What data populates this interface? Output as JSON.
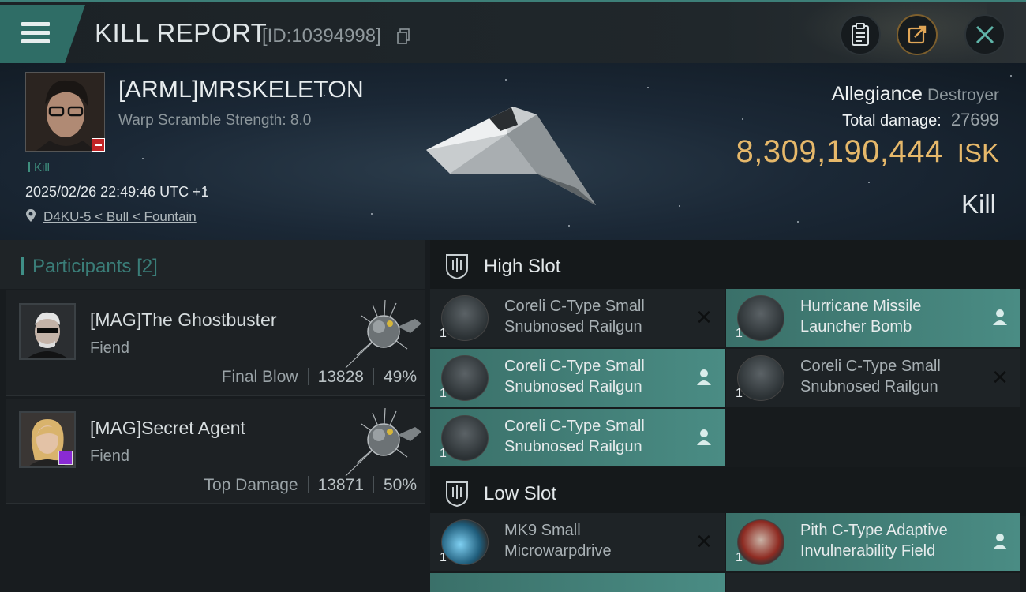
{
  "header": {
    "title": "KILL REPORT",
    "report_id": "[ID:10394998]",
    "icons": [
      "menu-icon",
      "copy-icon",
      "clipboard-icon",
      "share-icon",
      "close-icon"
    ]
  },
  "victim": {
    "name": "[ARML]MRSKELETON",
    "warp_scramble": "Warp Scramble Strength: 8.0",
    "tag": "Kill",
    "datetime": "2025/02/26 22:49:46 UTC +1",
    "location": "D4KU-5 < Bull < Fountain",
    "allegiance_label": "Allegiance",
    "allegiance_value": "Destroyer",
    "damage_label": "Total damage:",
    "damage_value": "27699",
    "isk_value": "8,309,190,444",
    "isk_unit": "ISK",
    "result": "Kill"
  },
  "participants": {
    "title": "Participants",
    "count": "[2]",
    "items": [
      {
        "name": "[MAG]The Ghostbuster",
        "role": "Fiend",
        "label": "Final Blow",
        "damage": "13828",
        "percent": "49%"
      },
      {
        "name": "[MAG]Secret Agent",
        "role": "Fiend",
        "label": "Top Damage",
        "damage": "13871",
        "percent": "50%"
      }
    ]
  },
  "fitting": {
    "high_slot": {
      "title": "High Slot",
      "modules": [
        {
          "qty": "1",
          "name": "Coreli C-Type Small Snubnosed Railgun",
          "status": "destroyed"
        },
        {
          "qty": "1",
          "name": "Hurricane Missile Launcher Bomb",
          "status": "dropped"
        },
        {
          "qty": "1",
          "name": "Coreli C-Type Small Snubnosed Railgun",
          "status": "dropped"
        },
        {
          "qty": "1",
          "name": "Coreli C-Type Small Snubnosed Railgun",
          "status": "destroyed"
        },
        {
          "qty": "1",
          "name": "Coreli C-Type Small Snubnosed Railgun",
          "status": "dropped"
        }
      ]
    },
    "low_slot": {
      "title": "Low Slot",
      "modules": [
        {
          "qty": "1",
          "name": "MK9 Small Microwarpdrive",
          "status": "destroyed"
        },
        {
          "qty": "1",
          "name": "Pith C-Type Adaptive Invulnerability Field",
          "status": "dropped"
        }
      ]
    }
  },
  "colors": {
    "accent": "#3f8f87",
    "isk": "#e6b86a",
    "dropped": "#4a8c84"
  }
}
